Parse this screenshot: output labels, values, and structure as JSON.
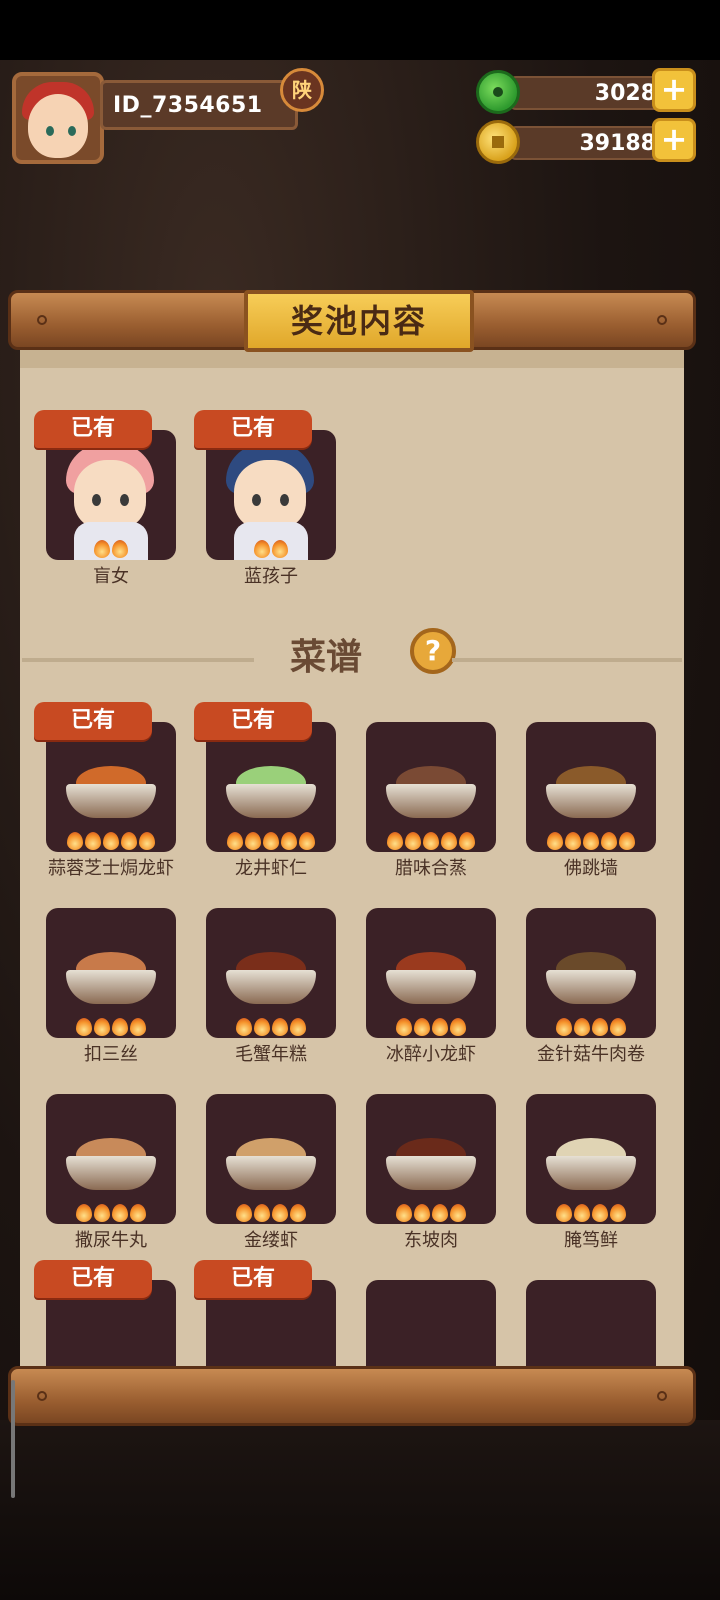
{
  "profile": {
    "id": "ID_7354651",
    "region_badge": "陕"
  },
  "currencies": [
    {
      "name": "jade",
      "value": "3028",
      "plus": "+"
    },
    {
      "name": "coin",
      "value": "39188",
      "plus": "+"
    }
  ],
  "panel": {
    "title": "奖池内容"
  },
  "owned_label": "已有",
  "characters": [
    {
      "name": "盲女",
      "owned": true,
      "hair": "#f0a0a0"
    },
    {
      "name": "蓝孩子",
      "owned": true,
      "hair": "#2e4a80"
    }
  ],
  "recipes_section": {
    "title": "菜谱",
    "help": "?"
  },
  "recipes": [
    {
      "name": "蒜蓉芝士焗龙虾",
      "owned": true,
      "flames": 5,
      "food": "#d06a2a"
    },
    {
      "name": "龙井虾仁",
      "owned": true,
      "flames": 5,
      "food": "#9ad07a"
    },
    {
      "name": "腊味合蒸",
      "owned": false,
      "flames": 5,
      "food": "#7a4a34"
    },
    {
      "name": "佛跳墙",
      "owned": false,
      "flames": 5,
      "food": "#8a5a2a"
    },
    {
      "name": "扣三丝",
      "owned": false,
      "flames": 4,
      "food": "#c87a4a"
    },
    {
      "name": "毛蟹年糕",
      "owned": false,
      "flames": 4,
      "food": "#7a2e1a"
    },
    {
      "name": "冰醉小龙虾",
      "owned": false,
      "flames": 4,
      "food": "#9a3a1e"
    },
    {
      "name": "金针菇牛肉卷",
      "owned": false,
      "flames": 4,
      "food": "#6a4a2a"
    },
    {
      "name": "撒尿牛丸",
      "owned": false,
      "flames": 4,
      "food": "#c88a5a"
    },
    {
      "name": "金缕虾",
      "owned": false,
      "flames": 4,
      "food": "#d0a06a"
    },
    {
      "name": "东坡肉",
      "owned": false,
      "flames": 4,
      "food": "#6a2a1a"
    },
    {
      "name": "腌笃鲜",
      "owned": false,
      "flames": 4,
      "food": "#e0d4b4"
    },
    {
      "name": "",
      "owned": true,
      "flames": 0,
      "food": ""
    },
    {
      "name": "",
      "owned": true,
      "flames": 0,
      "food": ""
    },
    {
      "name": "",
      "owned": false,
      "flames": 0,
      "food": ""
    },
    {
      "name": "",
      "owned": false,
      "flames": 0,
      "food": ""
    }
  ]
}
